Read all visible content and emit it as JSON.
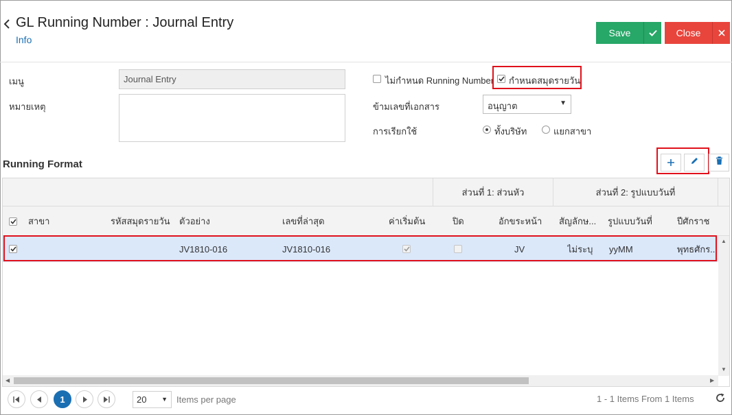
{
  "header": {
    "title": "GL Running Number : Journal Entry",
    "info_link": "Info",
    "save_label": "Save",
    "close_label": "Close"
  },
  "form": {
    "menu_label": "เมนู",
    "menu_value": "Journal Entry",
    "note_label": "หมายเหตุ",
    "note_value": "",
    "no_running_label": "ไม่กำหนด Running Number",
    "no_running_checked": false,
    "daily_book_label": "กำหนดสมุดรายวัน",
    "daily_book_checked": true,
    "skip_doc_label": "ข้ามเลขที่เอกสาร",
    "skip_doc_value": "อนุญาต",
    "usage_label": "การเรียกใช้",
    "usage_options": [
      "ทั้งบริษัท",
      "แยกสาขา"
    ],
    "usage_selected": "ทั้งบริษัท"
  },
  "section": {
    "title": "Running Format"
  },
  "grid": {
    "group_headers": [
      "ส่วนที่ 1: ส่วนหัว",
      "ส่วนที่ 2: รูปแบบวันที่"
    ],
    "columns": [
      "สาขา",
      "รหัสสมุดรายวัน",
      "ตัวอย่าง",
      "เลขที่ล่าสุด",
      "ค่าเริ่มต้น",
      "ปิด",
      "อักขระหน้า",
      "สัญลักษ...",
      "รูปแบบวันที่",
      "ปีศักราช"
    ],
    "rows": [
      {
        "checked": true,
        "branch": "",
        "journal_code": "",
        "example": "JV1810-016",
        "last_number": "JV1810-016",
        "is_default": true,
        "closed": false,
        "prefix": "JV",
        "symbol": "ไม่ระบุ",
        "date_format": "yyMM",
        "era": "พุทธศักร.."
      }
    ]
  },
  "pager": {
    "current_page": "1",
    "page_size": "20",
    "items_per_page_label": "Items per page",
    "items_info": "1 - 1 Items From 1 Items"
  }
}
